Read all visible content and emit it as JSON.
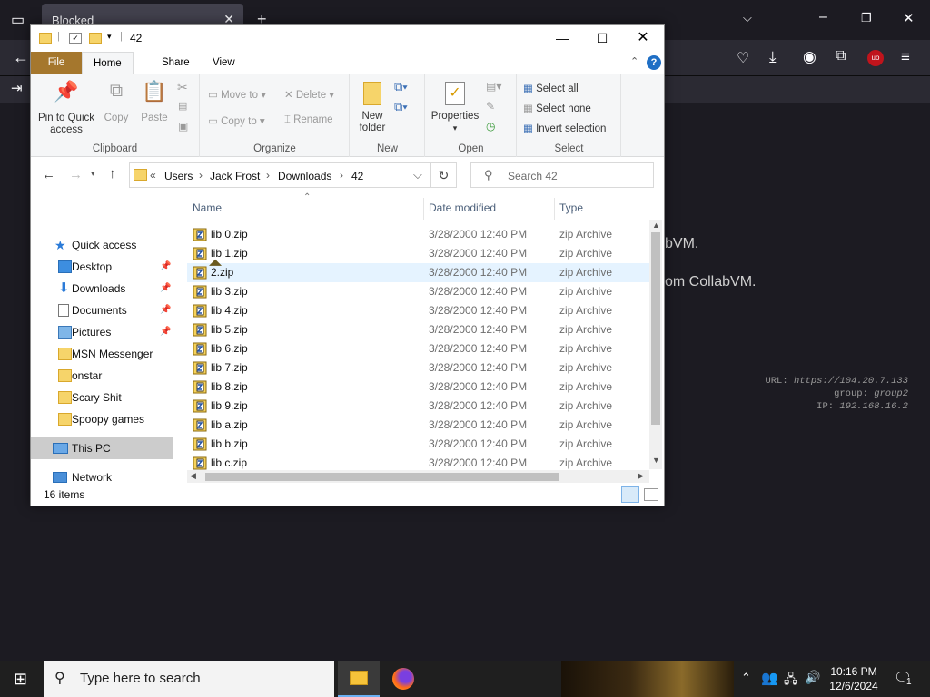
{
  "browser": {
    "tab_title": "Blocked",
    "background_lines": [
      "bVM.",
      "om CollabVM."
    ],
    "vm_info": {
      "url_label": "URL:",
      "url": "https://104.20.7.133",
      "group_label": "group:",
      "group": "group2",
      "ip_label": "IP:",
      "ip": "192.168.16.2"
    }
  },
  "explorer": {
    "title": "42",
    "tabs": [
      "File",
      "Home",
      "Share",
      "View"
    ],
    "ribbon": {
      "clipboard": {
        "label": "Clipboard",
        "pin": [
          "Pin to Quick",
          "access"
        ],
        "copy": "Copy",
        "paste": "Paste"
      },
      "organize": {
        "label": "Organize",
        "move_to": "Move to",
        "copy_to": "Copy to",
        "delete": "Delete",
        "rename": "Rename"
      },
      "new": {
        "label": "New",
        "new_folder": [
          "New",
          "folder"
        ]
      },
      "open": {
        "label": "Open",
        "properties": "Properties"
      },
      "select": {
        "label": "Select",
        "select_all": "Select all",
        "select_none": "Select none",
        "invert": "Invert selection"
      }
    },
    "breadcrumb": [
      "Users",
      "Jack Frost",
      "Downloads",
      "42"
    ],
    "search_placeholder": "Search 42",
    "nav": {
      "quick_access": "Quick access",
      "items": [
        {
          "label": "Desktop",
          "pinned": true
        },
        {
          "label": "Downloads",
          "pinned": true
        },
        {
          "label": "Documents",
          "pinned": true
        },
        {
          "label": "Pictures",
          "pinned": true
        },
        {
          "label": "MSN Messenger",
          "pinned": false
        },
        {
          "label": "onstar",
          "pinned": false
        },
        {
          "label": "Scary Shit",
          "pinned": false
        },
        {
          "label": "Spoopy games",
          "pinned": false
        }
      ],
      "this_pc": "This PC",
      "network": "Network"
    },
    "columns": {
      "name": "Name",
      "date": "Date modified",
      "type": "Type"
    },
    "files": [
      {
        "name": "lib 0.zip",
        "date": "3/28/2000 12:40 PM",
        "type": "zip Archive"
      },
      {
        "name": "lib 1.zip",
        "date": "3/28/2000 12:40 PM",
        "type": "zip Archive"
      },
      {
        "name": "2.zip",
        "date": "3/28/2000 12:40 PM",
        "type": "zip Archive"
      },
      {
        "name": "lib 3.zip",
        "date": "3/28/2000 12:40 PM",
        "type": "zip Archive"
      },
      {
        "name": "lib 4.zip",
        "date": "3/28/2000 12:40 PM",
        "type": "zip Archive"
      },
      {
        "name": "lib 5.zip",
        "date": "3/28/2000 12:40 PM",
        "type": "zip Archive"
      },
      {
        "name": "lib 6.zip",
        "date": "3/28/2000 12:40 PM",
        "type": "zip Archive"
      },
      {
        "name": "lib 7.zip",
        "date": "3/28/2000 12:40 PM",
        "type": "zip Archive"
      },
      {
        "name": "lib 8.zip",
        "date": "3/28/2000 12:40 PM",
        "type": "zip Archive"
      },
      {
        "name": "lib 9.zip",
        "date": "3/28/2000 12:40 PM",
        "type": "zip Archive"
      },
      {
        "name": "lib a.zip",
        "date": "3/28/2000 12:40 PM",
        "type": "zip Archive"
      },
      {
        "name": "lib b.zip",
        "date": "3/28/2000 12:40 PM",
        "type": "zip Archive"
      },
      {
        "name": "lib c.zip",
        "date": "3/28/2000 12:40 PM",
        "type": "zip Archive"
      }
    ],
    "status": "16 items"
  },
  "taskbar": {
    "search_placeholder": "Type here to search",
    "time": "10:16 PM",
    "date": "12/6/2024",
    "notifications": "1"
  }
}
